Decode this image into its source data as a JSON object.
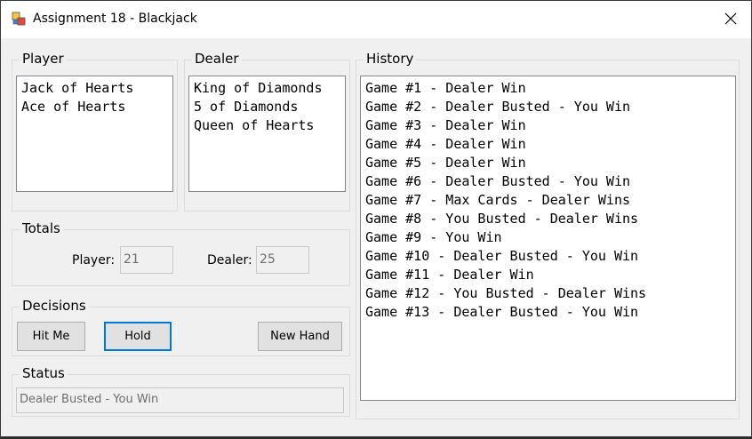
{
  "window": {
    "title": "Assignment 18 - Blackjack",
    "icon": "app-icon",
    "close_glyph": "✕"
  },
  "player": {
    "label": "Player",
    "cards": [
      "Jack of Hearts",
      "Ace of Hearts"
    ]
  },
  "dealer": {
    "label": "Dealer",
    "cards": [
      "King of Diamonds",
      "5 of Diamonds",
      "Queen of Hearts"
    ]
  },
  "totals": {
    "label": "Totals",
    "player_label": "Player:",
    "player_value": "21",
    "dealer_label": "Dealer:",
    "dealer_value": "25"
  },
  "decisions": {
    "label": "Decisions",
    "hit_label": "Hit Me",
    "hold_label": "Hold",
    "new_hand_label": "New Hand"
  },
  "status": {
    "label": "Status",
    "text": "Dealer Busted - You Win"
  },
  "history": {
    "label": "History",
    "items": [
      "Game #1 - Dealer Win",
      "Game #2 - Dealer Busted - You Win",
      "Game #3 - Dealer Win",
      "Game #4 - Dealer Win",
      "Game #5 - Dealer Win",
      "Game #6 - Dealer Busted - You Win",
      "Game #7 - Max Cards - Dealer Wins",
      "Game #8 - You Busted - Dealer Wins",
      "Game #9 - You Win",
      "Game #10 - Dealer Busted - You Win",
      "Game #11 - Dealer Win",
      "Game #12 - You Busted - Dealer Wins",
      "Game #13 - Dealer Busted - You Win"
    ]
  }
}
